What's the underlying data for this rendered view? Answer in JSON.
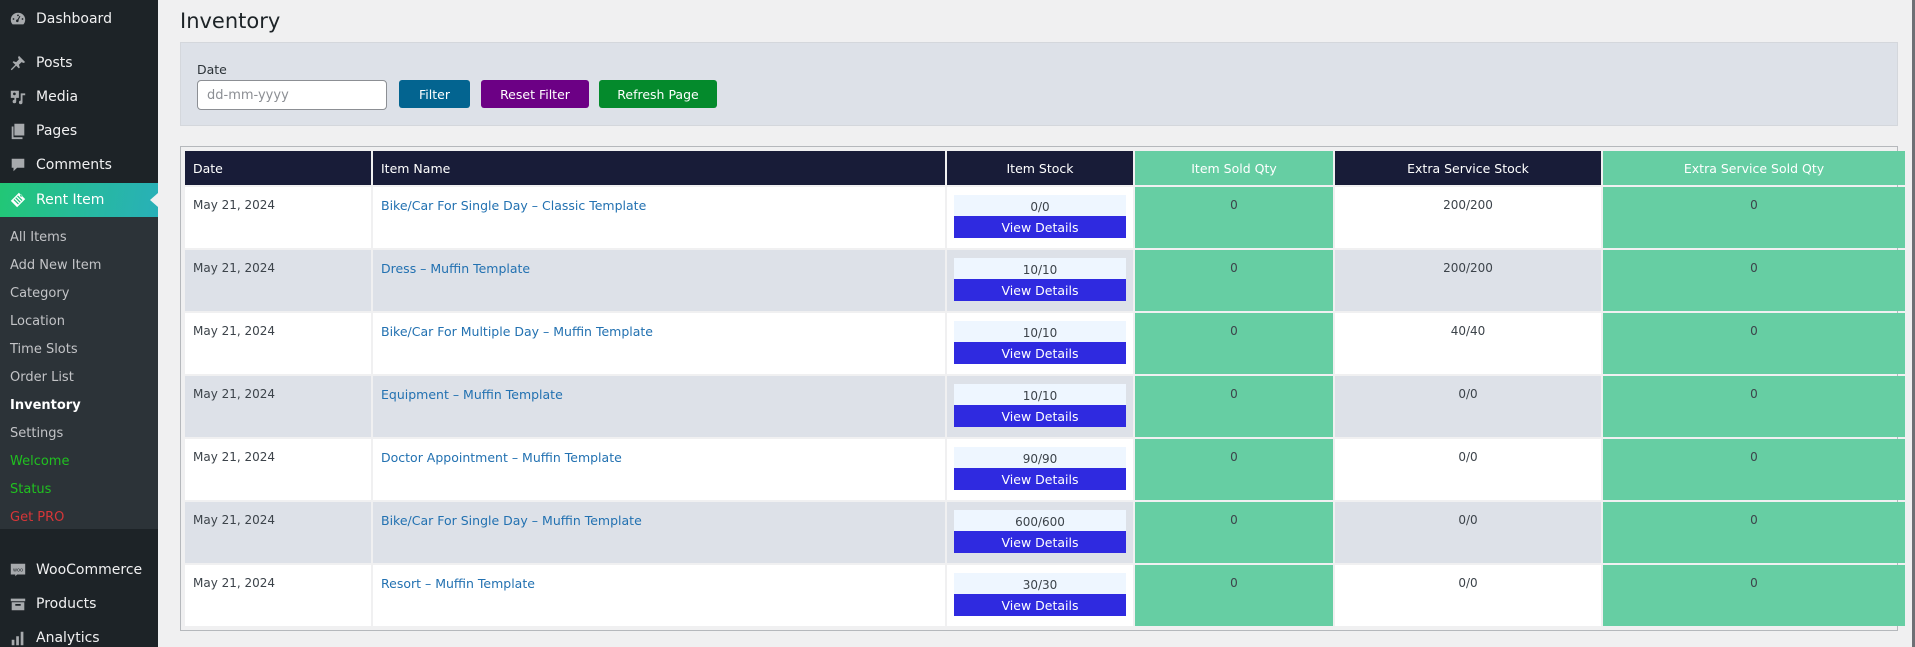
{
  "sidebar": {
    "top_items": [
      {
        "label": "Dashboard",
        "icon": "dashboard-icon"
      },
      {
        "label": "Posts",
        "icon": "pin-icon"
      },
      {
        "label": "Media",
        "icon": "media-icon"
      },
      {
        "label": "Pages",
        "icon": "pages-icon"
      },
      {
        "label": "Comments",
        "icon": "comment-icon"
      }
    ],
    "active_item": {
      "label": "Rent Item",
      "icon": "tag-icon"
    },
    "submenu": [
      {
        "label": "All Items"
      },
      {
        "label": "Add New Item"
      },
      {
        "label": "Category"
      },
      {
        "label": "Location"
      },
      {
        "label": "Time Slots"
      },
      {
        "label": "Order List"
      },
      {
        "label": "Inventory",
        "current": true
      },
      {
        "label": "Settings"
      },
      {
        "label": "Welcome",
        "color": "#20c020"
      },
      {
        "label": "Status",
        "color": "#20c020"
      },
      {
        "label": "Get PRO",
        "color": "#d63638"
      }
    ],
    "bottom_items": [
      {
        "label": "WooCommerce",
        "icon": "woo-icon"
      },
      {
        "label": "Products",
        "icon": "archive-icon"
      },
      {
        "label": "Analytics",
        "icon": "bar-chart-icon"
      }
    ]
  },
  "page": {
    "title": "Inventory"
  },
  "filter": {
    "date_label": "Date",
    "date_placeholder": "dd-mm-yyyy",
    "date_value": "",
    "filter_label": "Filter",
    "reset_label": "Reset Filter",
    "refresh_label": "Refresh Page",
    "colors": {
      "filter": "#036490",
      "reset": "#6c0085",
      "refresh": "#048a2c"
    }
  },
  "table": {
    "headers": [
      "Date",
      "Item Name",
      "Item Stock",
      "Item Sold Qty",
      "Extra Service Stock",
      "Extra Service Sold Qty"
    ],
    "view_details_label": "View Details",
    "rows": [
      {
        "date": "May 21, 2024",
        "item_name": "Bike/Car For Single Day – Classic Template",
        "item_stock": "0/0",
        "item_sold_qty": "0",
        "extra_service_stock": "200/200",
        "extra_service_sold_qty": "0"
      },
      {
        "date": "May 21, 2024",
        "item_name": "Dress – Muffin Template",
        "item_stock": "10/10",
        "item_sold_qty": "0",
        "extra_service_stock": "200/200",
        "extra_service_sold_qty": "0"
      },
      {
        "date": "May 21, 2024",
        "item_name": "Bike/Car For Multiple Day – Muffin Template",
        "item_stock": "10/10",
        "item_sold_qty": "0",
        "extra_service_stock": "40/40",
        "extra_service_sold_qty": "0"
      },
      {
        "date": "May 21, 2024",
        "item_name": "Equipment – Muffin Template",
        "item_stock": "10/10",
        "item_sold_qty": "0",
        "extra_service_stock": "0/0",
        "extra_service_sold_qty": "0"
      },
      {
        "date": "May 21, 2024",
        "item_name": "Doctor Appointment – Muffin Template",
        "item_stock": "90/90",
        "item_sold_qty": "0",
        "extra_service_stock": "0/0",
        "extra_service_sold_qty": "0"
      },
      {
        "date": "May 21, 2024",
        "item_name": "Bike/Car For Single Day – Muffin Template",
        "item_stock": "600/600",
        "item_sold_qty": "0",
        "extra_service_stock": "0/0",
        "extra_service_sold_qty": "0"
      },
      {
        "date": "May 21, 2024",
        "item_name": "Resort – Muffin Template",
        "item_stock": "30/30",
        "item_sold_qty": "0",
        "extra_service_stock": "0/0",
        "extra_service_sold_qty": "0"
      }
    ],
    "colors": {
      "header_dark": "#181c38",
      "header_green": "#66cea3",
      "view_button": "#2f2ae0",
      "link": "#2271b1"
    }
  }
}
